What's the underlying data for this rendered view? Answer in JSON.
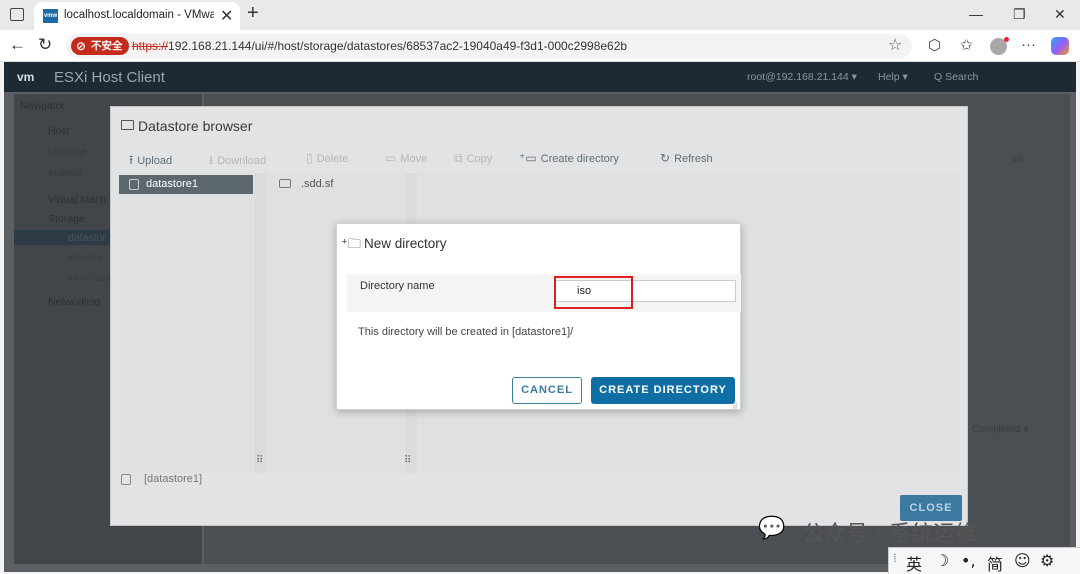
{
  "browser": {
    "tab_title": "localhost.localdomain - VMware E",
    "favicon_text": "vmw",
    "tab_close": "✕",
    "new_tab": "+",
    "win_min": "—",
    "win_max": "❐",
    "win_close": "✕",
    "back": "←",
    "reload": "↻",
    "insecure_label": "不安全",
    "url_scheme": "https://",
    "url_rest": "192.168.21.144/ui/#/host/storage/datastores/68537ac2-19040a49-f3d1-000c2998e62b",
    "star": "☆",
    "ext_icon": "⬡",
    "fav_icon": "✩",
    "more_icon": "···"
  },
  "esxi": {
    "logo": "vm",
    "title": "ESXi Host Client",
    "user": "root@192.168.21.144 ▾",
    "help": "Help ▾",
    "search": "Q  Search",
    "sidebar": {
      "navigator": "Navigator",
      "host": "Host",
      "manage": "Manage",
      "monitor": "Monitor",
      "virtual_machines": "Virtual Mach",
      "storage": "Storage",
      "datastore": "datastor",
      "sub_monitor": "Monitor",
      "sub_more": "More stor",
      "networking": "Networking"
    },
    "right_panel": {
      "stat_1": "1%",
      "completed": "Completed ▾"
    }
  },
  "datastore_browser": {
    "title": "Datastore browser",
    "toolbar": {
      "upload": "Upload",
      "download": "Download",
      "delete": "Delete",
      "move": "Move",
      "copy": "Copy",
      "create_directory": "Create directory",
      "refresh": "Refresh"
    },
    "datastores": [
      "datastore1"
    ],
    "folders": [
      ".sdd.sf"
    ],
    "footer_path": "[datastore1]",
    "close_label": "CLOSE"
  },
  "new_directory_dialog": {
    "title": "New directory",
    "field_label": "Directory name",
    "field_value": "iso",
    "info_text": "This directory will be created in [datastore1]/",
    "cancel_label": "CANCEL",
    "create_label": "CREATE DIRECTORY"
  },
  "watermark": {
    "text": "公众号 · 系统运维"
  },
  "ime": {
    "lang": "英",
    "moon": "☽",
    "punct": "•,",
    "simplified": "简",
    "emoji": "☺",
    "settings": "⚙"
  }
}
